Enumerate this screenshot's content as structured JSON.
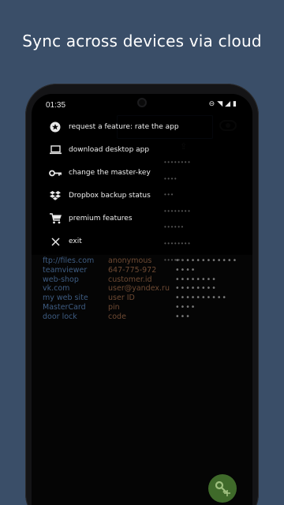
{
  "headline": "Sync across devices via cloud",
  "status_bar": {
    "time": "01:35"
  },
  "drawer": {
    "items": [
      {
        "label": "request a feature: rate the app",
        "icon": "star-badge-icon"
      },
      {
        "label": "download desktop app",
        "icon": "laptop-icon"
      },
      {
        "label": "change the master-key",
        "icon": "key-icon"
      },
      {
        "label": "Dropbox backup status",
        "icon": "dropbox-icon"
      },
      {
        "label": "premium features",
        "icon": "cart-icon"
      },
      {
        "label": "exit",
        "icon": "close-icon"
      }
    ]
  },
  "entries": [
    {
      "name": "ftp://files.com",
      "login": "anonymous",
      "password": "••••••••••••"
    },
    {
      "name": "teamviewer",
      "login": "647-775-972",
      "password": "••••"
    },
    {
      "name": "web-shop",
      "login": "customer.id",
      "password": "••••••••"
    },
    {
      "name": "vk.com",
      "login": "user@yandex.ru",
      "password": "••••••••"
    },
    {
      "name": "my web site",
      "login": "user ID",
      "password": "••••••••••"
    },
    {
      "name": "MasterCard",
      "login": "pin",
      "password": "••••"
    },
    {
      "name": "door lock",
      "login": "code",
      "password": "•••"
    }
  ],
  "colors": {
    "background": "#3a4e68",
    "entry_name": "#3e5c82",
    "entry_login": "#6e4a33",
    "fab": "#3f6a2a"
  }
}
